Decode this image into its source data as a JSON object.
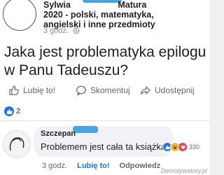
{
  "post": {
    "group_name_lines": [
      "Sylwia ",
      "Matura",
      "2020 - polski, matematyka,",
      "angielski i inne przedmioty"
    ],
    "time": "3 godz.",
    "text": "Jaka jest problematyka epilogu w Panu Tadeuszu?"
  },
  "actions": {
    "like": "Lubię to!",
    "comment": "Skomentuj",
    "share": "Udostępnij"
  },
  "reactions": {
    "count": "2"
  },
  "comment": {
    "author": "Szczepan",
    "text": "Problemem jest cała ta książka",
    "reaction_count": "330",
    "time": "3 godz.",
    "like": "Lubię to!",
    "reply": "Odpowiedz"
  },
  "watermark": "Demotywatory.pl",
  "colors": {
    "accent": "#1877f2",
    "muted": "#65676b"
  }
}
